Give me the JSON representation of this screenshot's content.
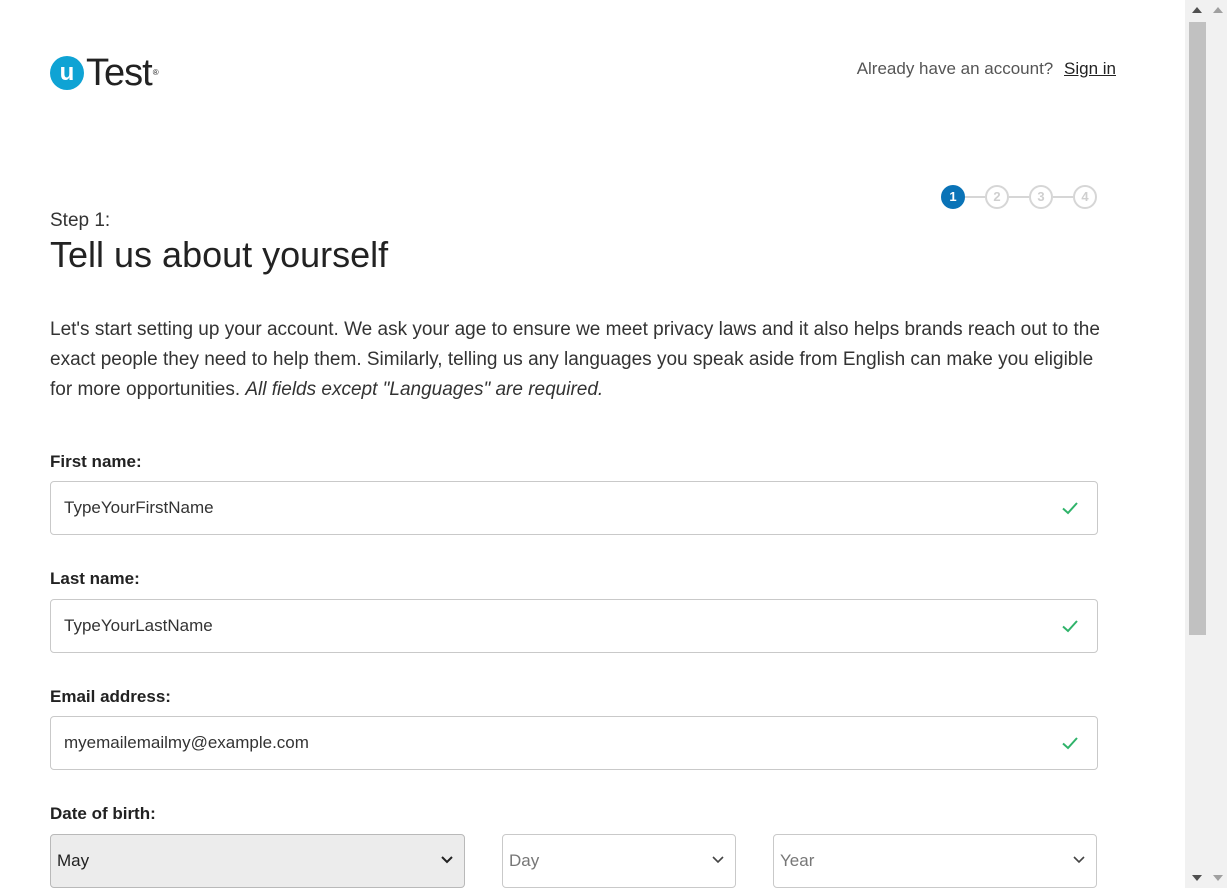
{
  "header": {
    "logo_text": "Test",
    "logo_mark": "u",
    "logo_reg": "®",
    "account_prompt": "Already have an account?",
    "sign_in_label": "Sign in"
  },
  "stepper": {
    "steps": [
      "1",
      "2",
      "3",
      "4"
    ],
    "active_step": 1,
    "active_color": "#0a73b7"
  },
  "main": {
    "step_label": "Step 1:",
    "title": "Tell us about yourself",
    "intro_text": "Let's start setting up your account. We ask your age to ensure we meet privacy laws and it also helps brands reach out to the exact people they need to help them. Similarly, telling us any languages you speak aside from English can make you eligible for more opportunities. ",
    "intro_italic": "All fields except \"Languages\" are required."
  },
  "form": {
    "first_name": {
      "label": "First name:",
      "value": "TypeYourFirstName",
      "valid_icon": "check-icon"
    },
    "last_name": {
      "label": "Last name:",
      "value": "TypeYourLastName",
      "valid_icon": "check-icon"
    },
    "email": {
      "label": "Email address:",
      "value": "myemailemailmy@example.com",
      "valid_icon": "check-icon"
    },
    "dob": {
      "label": "Date of birth:",
      "month": "May",
      "day_placeholder": "Day",
      "year_placeholder": "Year"
    }
  },
  "colors": {
    "brand": "#0fa3d4",
    "valid_check": "#2fb36a"
  }
}
